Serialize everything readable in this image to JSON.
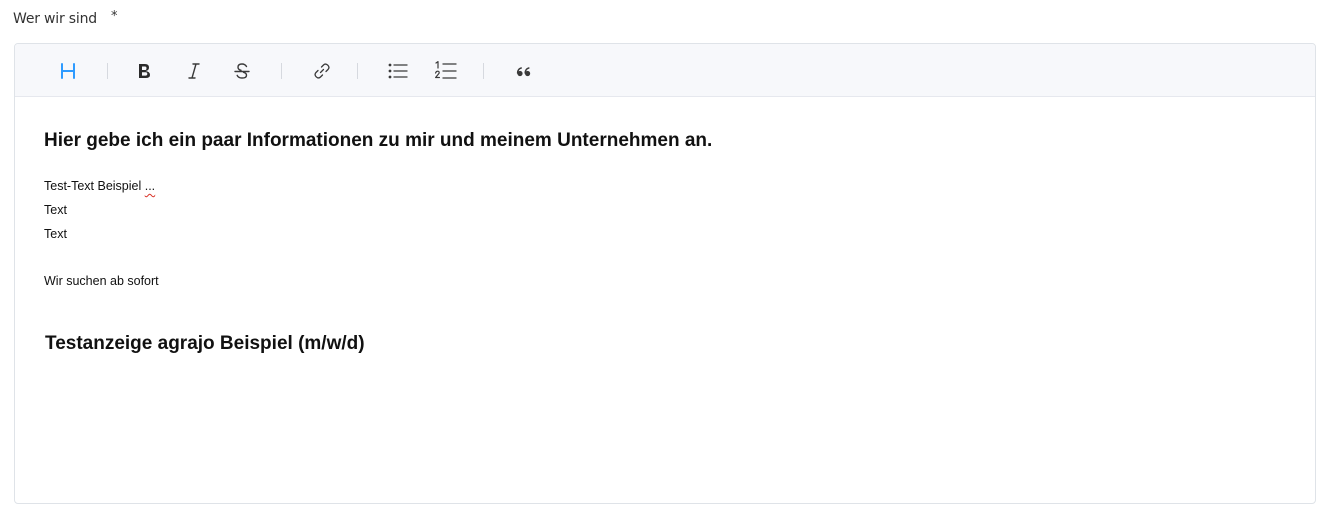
{
  "field": {
    "label": "Wer wir sind",
    "required_mark": "*"
  },
  "toolbar": {
    "buttons": [
      {
        "name": "heading",
        "icon": "heading-icon",
        "active": true
      },
      {
        "name": "bold",
        "icon": "bold-icon"
      },
      {
        "name": "italic",
        "icon": "italic-icon"
      },
      {
        "name": "strikethrough",
        "icon": "strikethrough-icon"
      },
      {
        "name": "link",
        "icon": "link-icon"
      },
      {
        "name": "bullet-list",
        "icon": "bullet-list-icon"
      },
      {
        "name": "numbered-list",
        "icon": "numbered-list-icon"
      },
      {
        "name": "quote",
        "icon": "quote-icon"
      }
    ],
    "active_color": "#2e9bff",
    "icon_color": "#3a3a3a"
  },
  "editor": {
    "heading": "Hier gebe ich ein paar Informationen zu mir und meinem Unternehmen an.",
    "line1_text": "Test-Text Beispiel ",
    "line1_misspelled": "...",
    "line2": "Text",
    "line3": "Text",
    "line4": "Wir suchen ab sofort",
    "subheading": "Testanzeige agrajo Beispiel (m/w/d)"
  }
}
